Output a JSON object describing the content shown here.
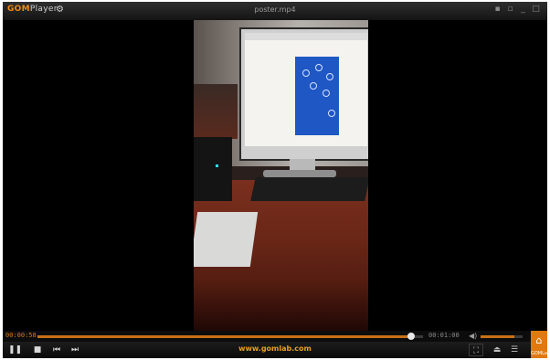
{
  "titlebar": {
    "brand_gom": "GOM",
    "brand_player": "Player",
    "filename": "poster.mp4"
  },
  "seek": {
    "current_time": "00:00:58",
    "total_time": "00:01:00",
    "progress": 0.97,
    "volume": 0.8
  },
  "controls": {
    "site_link": "www.gomlab.com"
  },
  "home": {
    "label": "GOMLab"
  },
  "colors": {
    "accent": "#e07a10",
    "background": "#000000"
  }
}
